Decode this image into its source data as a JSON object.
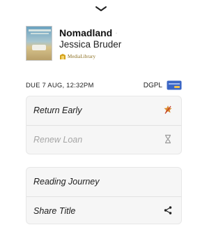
{
  "book": {
    "title": "Nomadland",
    "title_separator": "·",
    "author": "Jessica Bruder",
    "source_brand": "MediaLibrary"
  },
  "loan": {
    "due_label": "DUE 7 AUG, 12:32PM",
    "library_code": "DGPL"
  },
  "actions_primary": [
    {
      "label": "Return Early",
      "icon": "return-early-icon",
      "enabled": true
    },
    {
      "label": "Renew Loan",
      "icon": "hourglass-icon",
      "enabled": false
    }
  ],
  "actions_secondary": [
    {
      "label": "Reading Journey",
      "icon": "",
      "enabled": true
    },
    {
      "label": "Share Title",
      "icon": "share-icon",
      "enabled": true
    }
  ],
  "colors": {
    "brand_gold": "#d4a21b",
    "return_icon": "#d9892a",
    "library_card_blue": "#3b66c4"
  }
}
